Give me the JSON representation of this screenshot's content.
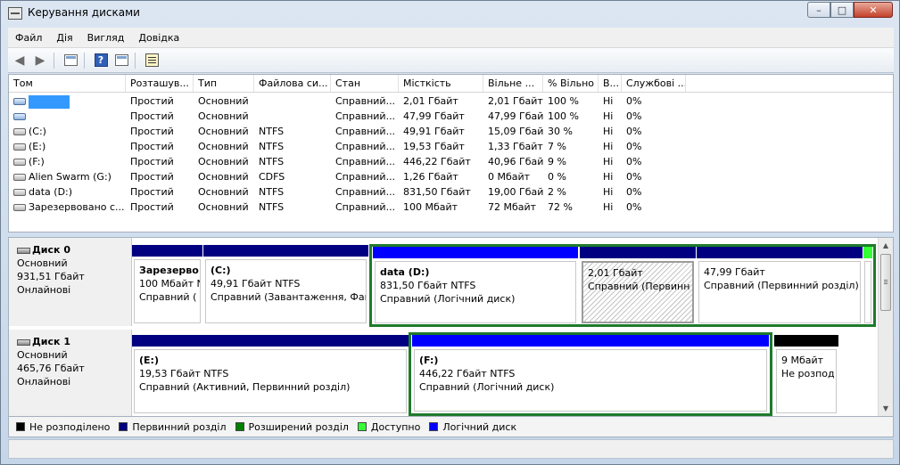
{
  "window": {
    "title": "Керування дисками",
    "minimize": "–",
    "maximize": "□",
    "close": "✕"
  },
  "menu": [
    "Файл",
    "Дія",
    "Вигляд",
    "Довідка"
  ],
  "table": {
    "headers": [
      "Том",
      "Розташув...",
      "Тип",
      "Файлова си...",
      "Стан",
      "Місткість",
      "Вільне ...",
      "% Вільно",
      "В...",
      "Службові ..."
    ],
    "rows": [
      [
        "",
        "Простий",
        "Основний",
        "",
        "Справний...",
        "2,01 Гбайт",
        "2,01 Гбайт",
        "100 %",
        "Ні",
        "0%"
      ],
      [
        "",
        "Простий",
        "Основний",
        "",
        "Справний...",
        "47,99 Гбайт",
        "47,99 Гбайт",
        "100 %",
        "Ні",
        "0%"
      ],
      [
        "(C:)",
        "Простий",
        "Основний",
        "NTFS",
        "Справний...",
        "49,91 Гбайт",
        "15,09 Гбайт",
        "30 %",
        "Ні",
        "0%"
      ],
      [
        "(E:)",
        "Простий",
        "Основний",
        "NTFS",
        "Справний...",
        "19,53 Гбайт",
        "1,33 Гбайт",
        "7 %",
        "Ні",
        "0%"
      ],
      [
        "(F:)",
        "Простий",
        "Основний",
        "NTFS",
        "Справний...",
        "446,22 Гбайт",
        "40,96 Гбайт",
        "9 %",
        "Ні",
        "0%"
      ],
      [
        "Alien Swarm (G:)",
        "Простий",
        "Основний",
        "CDFS",
        "Справний...",
        "1,26 Гбайт",
        "0 Мбайт",
        "0 %",
        "Ні",
        "0%"
      ],
      [
        "data (D:)",
        "Простий",
        "Основний",
        "NTFS",
        "Справний...",
        "831,50 Гбайт",
        "19,00 Гбайт",
        "2 %",
        "Ні",
        "0%"
      ],
      [
        "Зарезервовано с...",
        "Простий",
        "Основний",
        "NTFS",
        "Справний...",
        "100 Мбайт",
        "72 Мбайт",
        "72 %",
        "Ні",
        "0%"
      ]
    ]
  },
  "disks": [
    {
      "name": "Диск 0",
      "type": "Основний",
      "size": "931,51 Гбайт",
      "status": "Онлайнові",
      "partitions": [
        {
          "name": "Зарезерво",
          "line1": "100 Мбайт N",
          "line2": "Справний ("
        },
        {
          "name": "(C:)",
          "line1": "49,91 Гбайт NTFS",
          "line2": "Справний (Завантаження, Файл"
        },
        {
          "name": "data  (D:)",
          "line1": "831,50 Гбайт NTFS",
          "line2": "Справний (Логічний диск)"
        },
        {
          "name": "",
          "line1": "2,01 Гбайт",
          "line2": "Справний (Первинн"
        },
        {
          "name": "",
          "line1": "47,99 Гбайт",
          "line2": "Справний (Первинний розділ)"
        }
      ]
    },
    {
      "name": "Диск 1",
      "type": "Основний",
      "size": "465,76 Гбайт",
      "status": "Онлайнові",
      "partitions": [
        {
          "name": "(E:)",
          "line1": "19,53 Гбайт NTFS",
          "line2": "Справний (Активний, Первинний розділ)"
        },
        {
          "name": "(F:)",
          "line1": "446,22 Гбайт NTFS",
          "line2": "Справний (Логічний диск)"
        },
        {
          "name": "",
          "line1": "9 Мбайт",
          "line2": "Не розпод"
        }
      ]
    }
  ],
  "legend": [
    {
      "label": "Не розподілено",
      "color": "#000000"
    },
    {
      "label": "Первинний розділ",
      "color": "#000080"
    },
    {
      "label": "Розширений розділ",
      "color": "#008000"
    },
    {
      "label": "Доступно",
      "color": "#33ff33"
    },
    {
      "label": "Логічний диск",
      "color": "#0000ff"
    }
  ],
  "colors": {
    "primary": "#000080",
    "logical": "#0000ff",
    "unallocated": "#000000",
    "extended_border": "#1f7a2c",
    "free": "#33ff33",
    "selection": "#3399ff"
  },
  "icons": {
    "back": "back-arrow-icon",
    "forward": "forward-arrow-icon",
    "help": "help-icon"
  }
}
